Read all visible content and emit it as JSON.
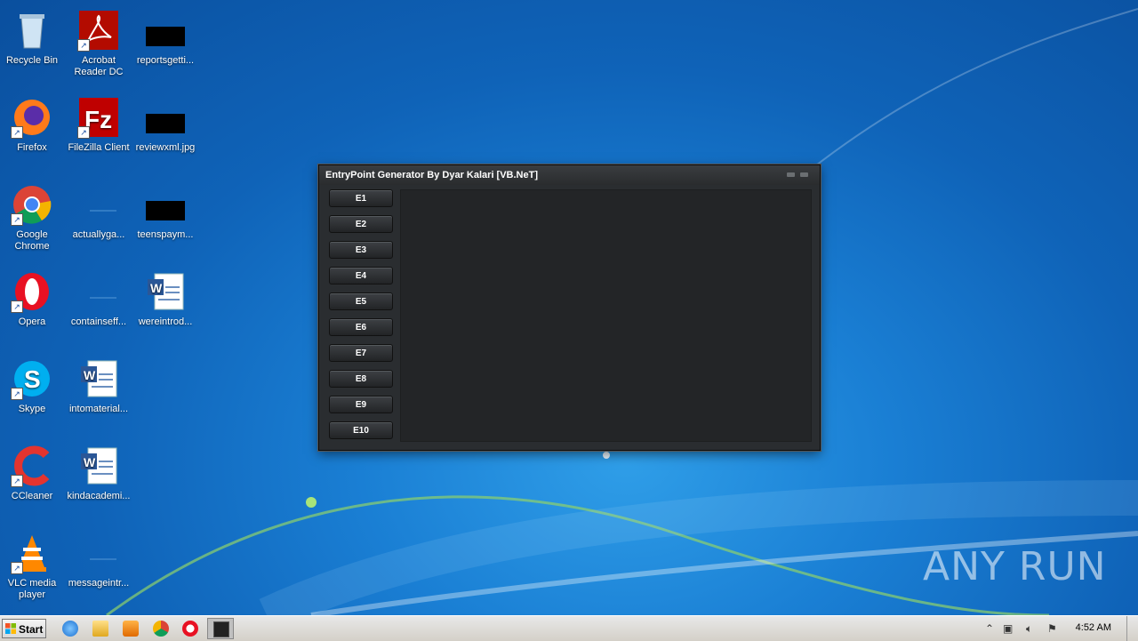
{
  "desktop": {
    "icons": [
      {
        "label": "Recycle Bin",
        "icon": "recycle-bin-icon"
      },
      {
        "label": "Acrobat Reader DC",
        "icon": "acrobat-icon"
      },
      {
        "label": "reportsgetti...",
        "icon": "file-icon"
      },
      {
        "label": "Firefox",
        "icon": "firefox-icon"
      },
      {
        "label": "FileZilla Client",
        "icon": "filezilla-icon"
      },
      {
        "label": "reviewxml.jpg",
        "icon": "image-file-icon"
      },
      {
        "label": "Google Chrome",
        "icon": "chrome-icon"
      },
      {
        "label": "actuallyga...",
        "icon": "file-icon"
      },
      {
        "label": "teenspaym...",
        "icon": "file-icon"
      },
      {
        "label": "Opera",
        "icon": "opera-icon"
      },
      {
        "label": "containseff...",
        "icon": "file-icon"
      },
      {
        "label": "wereintrod...",
        "icon": "word-doc-icon"
      },
      {
        "label": "Skype",
        "icon": "skype-icon"
      },
      {
        "label": "intomaterial...",
        "icon": "word-doc-icon"
      },
      {
        "label": "CCleaner",
        "icon": "ccleaner-icon"
      },
      {
        "label": "kindacademi...",
        "icon": "word-doc-icon"
      },
      {
        "label": "VLC media player",
        "icon": "vlc-icon"
      },
      {
        "label": "messageintr...",
        "icon": "file-icon"
      }
    ]
  },
  "window": {
    "title": "EntryPoint Generator By Dyar Kalari [VB.NeT]",
    "buttons": [
      "E1",
      "E2",
      "E3",
      "E4",
      "E5",
      "E6",
      "E7",
      "E8",
      "E9",
      "E10"
    ]
  },
  "taskbar": {
    "start_label": "Start",
    "clock": "4:52 AM"
  },
  "watermark": "ANY RUN"
}
